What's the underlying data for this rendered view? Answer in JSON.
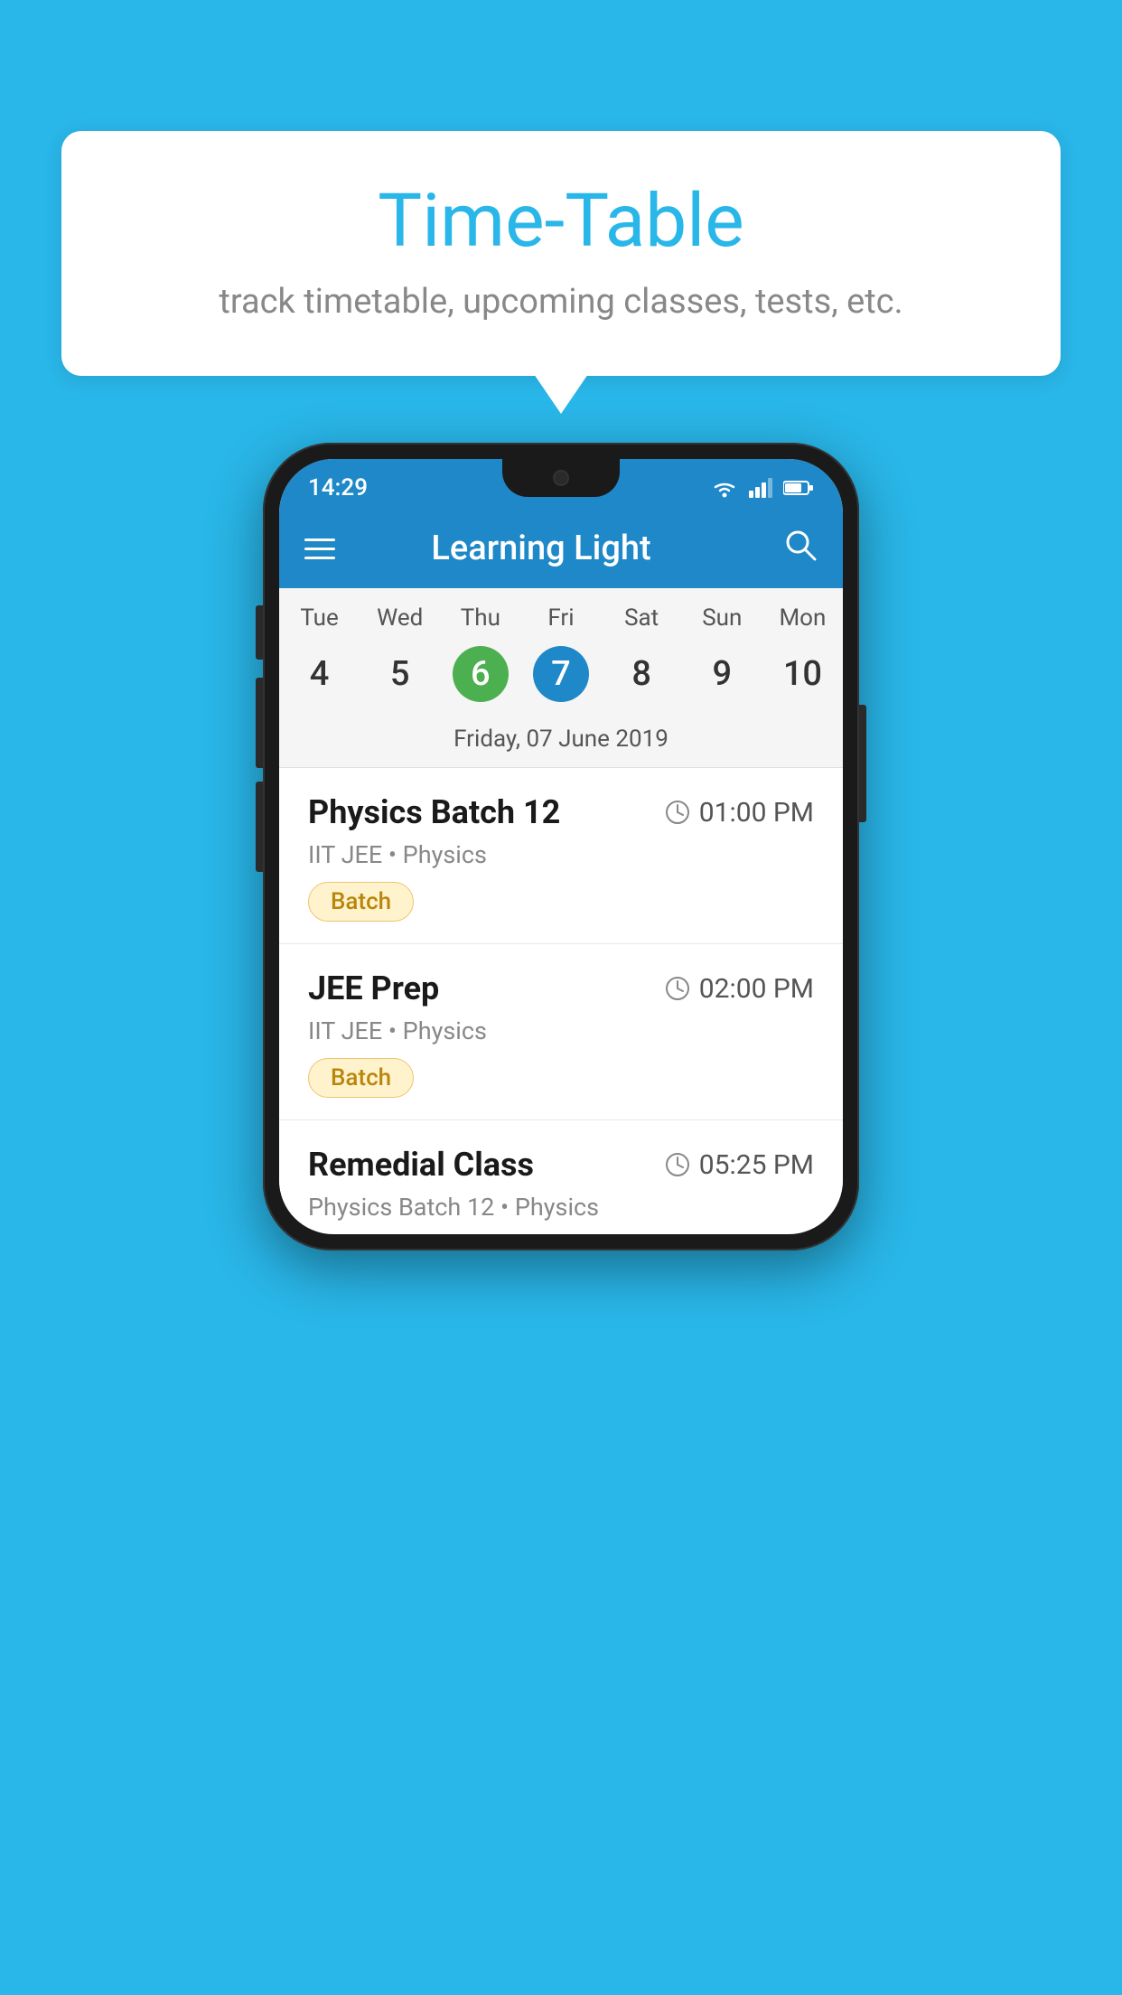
{
  "background_color": "#29b6e8",
  "bubble": {
    "title": "Time-Table",
    "subtitle": "track timetable, upcoming classes, tests, etc."
  },
  "status_bar": {
    "time": "14:29"
  },
  "app_bar": {
    "title": "Learning Light"
  },
  "calendar": {
    "days": [
      {
        "label": "Tue",
        "number": "4"
      },
      {
        "label": "Wed",
        "number": "5"
      },
      {
        "label": "Thu",
        "number": "6",
        "state": "today"
      },
      {
        "label": "Fri",
        "number": "7",
        "state": "selected"
      },
      {
        "label": "Sat",
        "number": "8"
      },
      {
        "label": "Sun",
        "number": "9"
      },
      {
        "label": "Mon",
        "number": "10"
      }
    ],
    "selected_date": "Friday, 07 June 2019"
  },
  "schedule": [
    {
      "name": "Physics Batch 12",
      "time": "01:00 PM",
      "meta": "IIT JEE • Physics",
      "badge": "Batch"
    },
    {
      "name": "JEE Prep",
      "time": "02:00 PM",
      "meta": "IIT JEE • Physics",
      "badge": "Batch"
    },
    {
      "name": "Remedial Class",
      "time": "05:25 PM",
      "meta": "Physics Batch 12 • Physics",
      "badge": null
    }
  ],
  "icons": {
    "hamburger": "☰",
    "search": "🔍",
    "clock": "🕐"
  }
}
